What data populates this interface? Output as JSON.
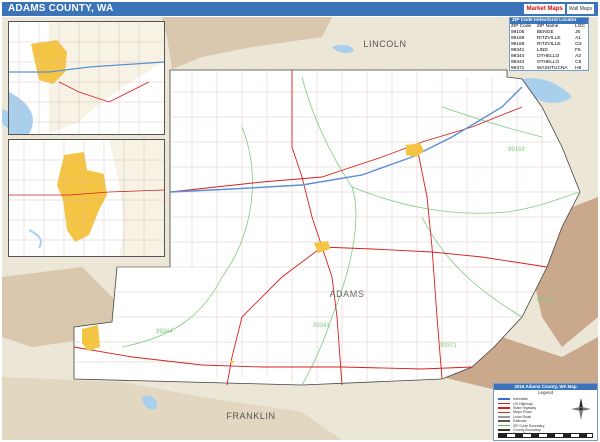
{
  "title": "ADAMS COUNTY, WA",
  "logo": {
    "brand": "Market Maps",
    "tagline": "Wall Maps"
  },
  "labels": {
    "lincoln": "LINCOLN",
    "adams": "ADAMS",
    "franklin": "FRANKLIN"
  },
  "zip_labels": [
    "99169",
    "99193",
    "99341",
    "99344",
    "99371"
  ],
  "zip_table": {
    "header": "ZIP Code Index/Grid Locator",
    "columns": [
      "ZIP Code",
      "ZIP Name",
      "LOC"
    ],
    "rows": [
      [
        "99105",
        "BENGE",
        "J5"
      ],
      [
        "99169",
        "RITZVILLE",
        "A1"
      ],
      [
        "99169",
        "RITZVILLE",
        "G3"
      ],
      [
        "99341",
        "LIND",
        "F5"
      ],
      [
        "99344",
        "OTHELLO",
        "A3"
      ],
      [
        "99344",
        "OTHELLO",
        "C5"
      ],
      [
        "99371",
        "WASHTUCNA",
        "H6"
      ]
    ]
  },
  "legend": {
    "header": "2016 Adams County, WA Map",
    "subheader": "Legend",
    "items": [
      {
        "label": "Interstate",
        "color": "#3a6fd0"
      },
      {
        "label": "US Highway",
        "color": "#d42020"
      },
      {
        "label": "State Highway",
        "color": "#d42020"
      },
      {
        "label": "Major Road",
        "color": "#c0392b"
      },
      {
        "label": "Local Road",
        "color": "#999999"
      },
      {
        "label": "Railroad",
        "color": "#555555"
      },
      {
        "label": "ZIP Code Boundary",
        "color": "#5cb85c"
      },
      {
        "label": "County Boundary",
        "color": "#333333"
      },
      {
        "label": "Water Body",
        "color": "#9cc9e8"
      }
    ]
  },
  "colors": {
    "title_bar": "#3b74b8",
    "county_land": "#ffffff",
    "outside_land": "#ece6d6",
    "terrain": "#c9a88c",
    "water": "#a8d0ec",
    "city": "#f4c542",
    "road_major": "#d42020",
    "road_minor": "#c99aa0",
    "zip_boundary": "#7fc97f",
    "interstate": "#5b8fd6"
  }
}
